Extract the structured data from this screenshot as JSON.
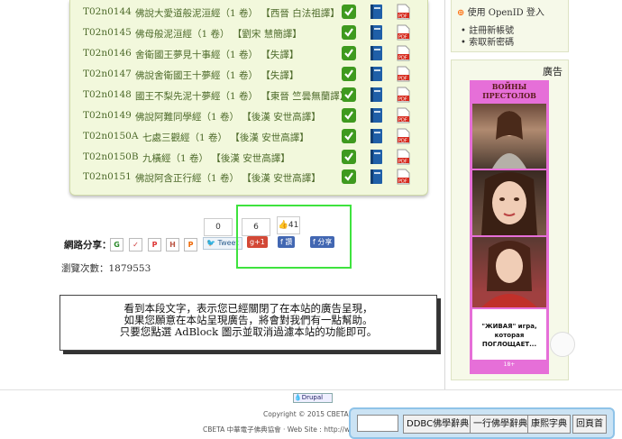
{
  "sutras": [
    {
      "id": "T02n0144",
      "title": "佛說大愛道般泥洹經（1 卷） 【西晉 白法祖譯】"
    },
    {
      "id": "T02n0145",
      "title": "佛母般泥洹經（1 卷） 【劉宋 慧簡譯】"
    },
    {
      "id": "T02n0146",
      "title": "舍衛國王夢見十事經（1 卷） 【失譯】"
    },
    {
      "id": "T02n0147",
      "title": "佛說舍衛國王十夢經（1 卷） 【失譯】"
    },
    {
      "id": "T02n0148",
      "title": "國王不梨先泥十夢經（1 卷） 【東晉 竺曇無蘭譯】"
    },
    {
      "id": "T02n0149",
      "title": "佛說阿難同學經（1 卷） 【後漢 安世高譯】"
    },
    {
      "id": "T02n0150A",
      "title": "七處三觀經（1 卷） 【後漢 安世高譯】"
    },
    {
      "id": "T02n0150B",
      "title": "九橫經（1 卷） 【後漢 安世高譯】"
    },
    {
      "id": "T02n0151",
      "title": "佛說阿含正行經（1 卷） 【後漢 安世高譯】"
    }
  ],
  "share": {
    "label": "網路分享：",
    "count_1": "0",
    "count_2": "6",
    "like_count": "41",
    "tweet_label": "Tweet",
    "gplus_label": "g+1",
    "fb_share_label": "讚",
    "fb_share2_label": "分享"
  },
  "views": "瀏覽次數：1879553",
  "adblock": {
    "line1": "看到本段文字，表示您已經關閉了在本站的廣告呈現，",
    "line2": "如果您願意在本站呈現廣告，將會對我們有一點幫助。",
    "line3": "只要您點選 AdBlock 圖示並取消過濾本站的功能即可。"
  },
  "sidebar": {
    "openid_login": "使用 OpenID 登入",
    "register": "註冊新帳號",
    "request_password": "索取新密碼",
    "ad_title": "廣告",
    "ad_banner_title": "ВОЙНЫ ПРЕСТОЛОВ",
    "ad_caption_1": "\"ЖИВАЯ\" игра, которая",
    "ad_caption_2": "ПОГЛОЩАЕТ...",
    "ad_age": "18+"
  },
  "footer": {
    "drupal": "Drupal",
    "copyright": "Copyright © 2015 CBETA 漢文大藏經",
    "line": "CBETA 中華電子佛典協會 · Web Site : http://www.cbeta.org · E-mail :"
  },
  "dict_bar": {
    "input_value": "",
    "btn_ddbc": "DDBC佛學辭典",
    "btn_yixing": "一行佛學辭典",
    "btn_kangxi": "康熙字典",
    "btn_home": "回頁首"
  },
  "colors": {
    "highlight": "#3ee33e",
    "panel_bg": "#f2f8dc",
    "dict_bar_bg": "#cbe3f4"
  }
}
